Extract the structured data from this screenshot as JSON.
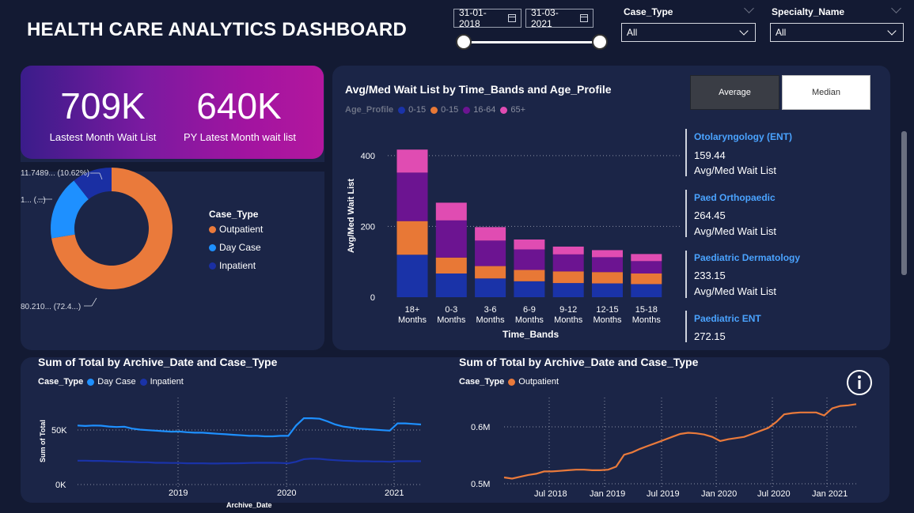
{
  "title": "HEALTH CARE ANALYTICS DASHBOARD",
  "date_range": {
    "start": "31-01-2018",
    "end": "31-03-2021"
  },
  "slicers": {
    "case_type": {
      "label": "Case_Type",
      "value": "All"
    },
    "specialty": {
      "label": "Specialty_Name",
      "value": "All"
    }
  },
  "kpis": [
    {
      "value": "709K",
      "label": "Lastest Month Wait List"
    },
    {
      "value": "640K",
      "label": "PY Latest Month wait list"
    }
  ],
  "donut": {
    "legend_title": "Case_Type",
    "labels": [
      "11.7489... (10.62%)",
      "1... (...)",
      "80.210... (72.4...)"
    ],
    "chart_data": {
      "type": "pie",
      "slices": [
        {
          "name": "Outpatient",
          "value": 72.4,
          "color": "#ea7a3b"
        },
        {
          "name": "Day Case",
          "value": 16.98,
          "color": "#1e90ff"
        },
        {
          "name": "Inpatient",
          "value": 10.62,
          "color": "#1a2fa3"
        }
      ]
    }
  },
  "wait_chart": {
    "title": "Avg/Med Wait List by Time_Bands and Age_Profile",
    "legend_title": "Age_Profile",
    "ylabel": "Avg/Med Wait List",
    "xlabel": "Time_Bands",
    "toggle": {
      "average": "Average",
      "median": "Median"
    },
    "chart_data": {
      "type": "bar",
      "stacked": true,
      "categories": [
        [
          "18+",
          "Months"
        ],
        [
          "0-3",
          "Months"
        ],
        [
          "3-6",
          "Months"
        ],
        [
          "6-9",
          "Months"
        ],
        [
          "9-12",
          "Months"
        ],
        [
          "12-15",
          "Months"
        ],
        [
          "15-18",
          "Months"
        ]
      ],
      "ylim": [
        0,
        460
      ],
      "yticks": [
        0,
        200,
        400
      ],
      "series": [
        {
          "name": "0-15",
          "color": "#1a33a8",
          "values": [
            120,
            67,
            53,
            45,
            40,
            39,
            37
          ]
        },
        {
          "name": "0-15",
          "color": "#e87836",
          "values": [
            95,
            45,
            35,
            32,
            33,
            32,
            30
          ]
        },
        {
          "name": "16-64",
          "color": "#6c1491",
          "values": [
            137,
            105,
            72,
            58,
            48,
            42,
            35
          ]
        },
        {
          "name": "65+",
          "color": "#e04cb2",
          "values": [
            65,
            50,
            38,
            28,
            22,
            20,
            20
          ]
        }
      ]
    }
  },
  "specialty_cards": [
    {
      "name": "Otolaryngology (ENT)",
      "value": "159.44",
      "sub": "Avg/Med Wait List"
    },
    {
      "name": "Paed Orthopaedic",
      "value": "264.45",
      "sub": "Avg/Med Wait List"
    },
    {
      "name": "Paediatric Dermatology",
      "value": "233.15",
      "sub": "Avg/Med Wait List"
    },
    {
      "name": "Paediatric ENT",
      "value": "272.15",
      "sub": ""
    }
  ],
  "line_left": {
    "title": "Sum of Total by Archive_Date and Case_Type",
    "legend_title": "Case_Type",
    "ylabel": "Sum of Total",
    "xlabel": "Archive_Date",
    "yticks": [
      "50K",
      "0K"
    ],
    "xticks": [
      "2019",
      "2020",
      "2021"
    ],
    "chart_data": {
      "type": "line",
      "ylim": [
        0,
        90000
      ],
      "series": [
        {
          "name": "Day Case",
          "color": "#1e90ff",
          "values": [
            57000,
            56500,
            57000,
            56800,
            56000,
            55500,
            55800,
            54000,
            53000,
            52500,
            52000,
            51500,
            51000,
            51200,
            50500,
            50000,
            50000,
            49500,
            49000,
            48500,
            48000,
            47500,
            47000,
            47000,
            46500,
            46500,
            47000,
            47000,
            57000,
            64000,
            64000,
            63500,
            61000,
            58000,
            56000,
            55000,
            54000,
            53500,
            53000,
            52500,
            52000,
            59000,
            59000,
            58500,
            58000
          ]
        },
        {
          "name": "Inpatient",
          "color": "#1a33a8",
          "values": [
            23000,
            23000,
            22800,
            22800,
            22500,
            22300,
            22000,
            21800,
            21500,
            21500,
            21000,
            21000,
            20800,
            20800,
            20500,
            20500,
            20500,
            20300,
            20300,
            20500,
            20500,
            20600,
            20800,
            21000,
            21000,
            21000,
            20800,
            20500,
            22000,
            24500,
            25000,
            24800,
            24000,
            23500,
            23000,
            22800,
            22500,
            22500,
            22300,
            22300,
            22000,
            22500,
            22500,
            22500,
            22500
          ]
        }
      ]
    }
  },
  "line_right": {
    "title": "Sum of Total by Archive_Date and Case_Type",
    "legend_title": "Case_Type",
    "yticks": [
      "0.6M",
      "0.5M"
    ],
    "xticks": [
      "Jul 2018",
      "Jan 2019",
      "Jul 2019",
      "Jan 2020",
      "Jul 2020",
      "Jan 2021"
    ],
    "chart_data": {
      "type": "line",
      "ylim": [
        0.49,
        0.64
      ],
      "series": [
        {
          "name": "Outpatient",
          "color": "#ea7a3b",
          "values": [
            0.502,
            0.5,
            0.503,
            0.506,
            0.508,
            0.512,
            0.512,
            0.513,
            0.514,
            0.515,
            0.515,
            0.514,
            0.514,
            0.515,
            0.52,
            0.54,
            0.544,
            0.55,
            0.555,
            0.56,
            0.565,
            0.57,
            0.575,
            0.577,
            0.576,
            0.574,
            0.57,
            0.563,
            0.566,
            0.568,
            0.57,
            0.575,
            0.58,
            0.585,
            0.595,
            0.608,
            0.61,
            0.611,
            0.611,
            0.611,
            0.606,
            0.618,
            0.622,
            0.623,
            0.625
          ]
        }
      ]
    }
  }
}
